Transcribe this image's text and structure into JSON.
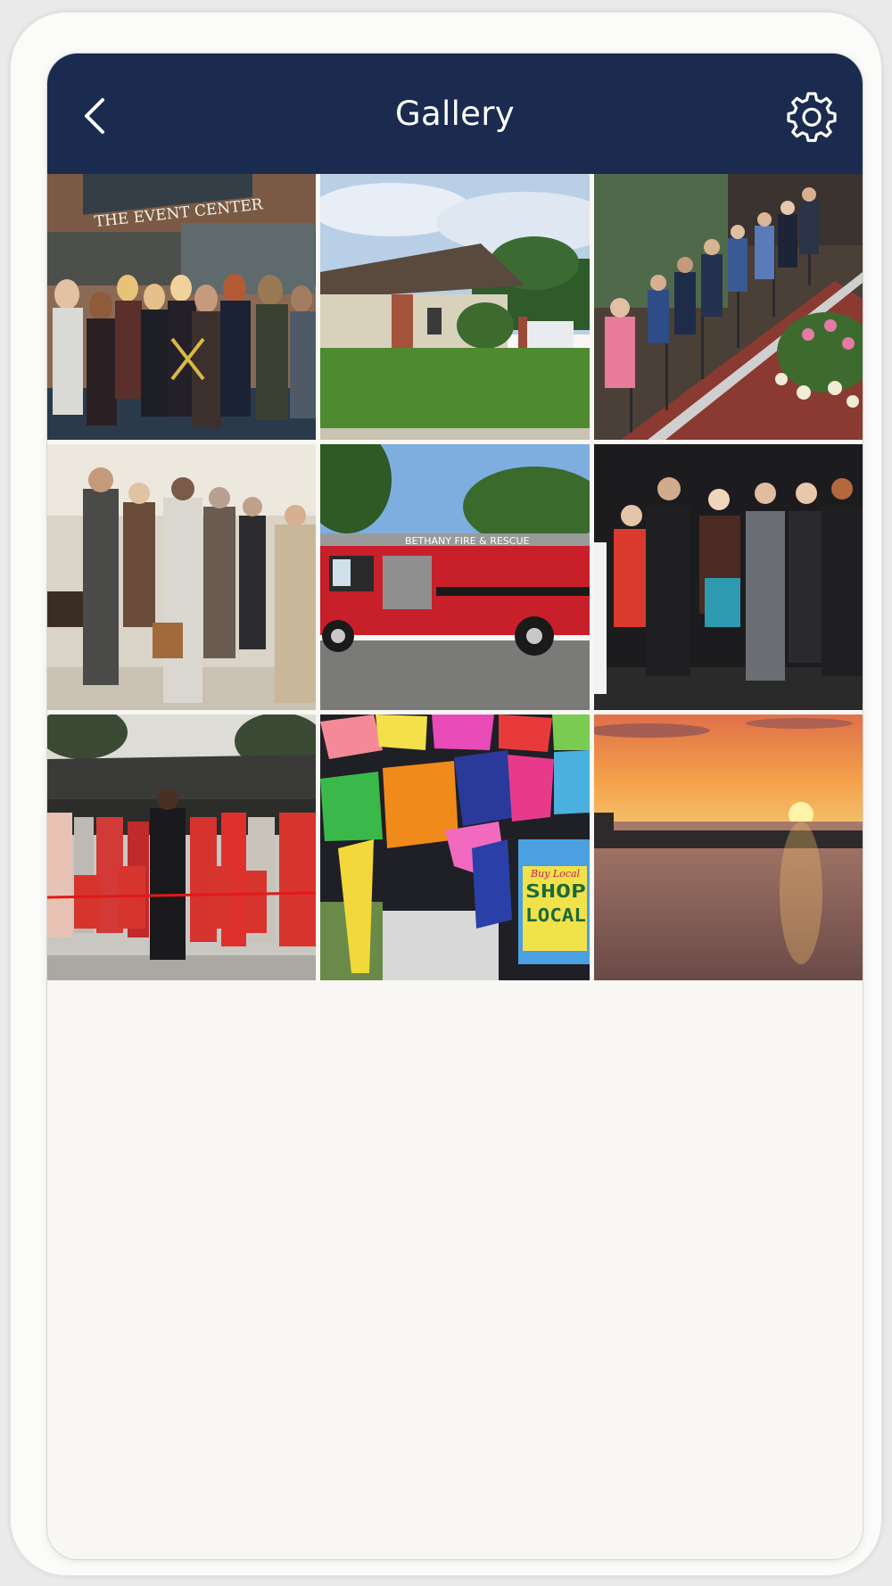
{
  "header": {
    "title": "Gallery",
    "background_color": "#1b2b4f",
    "back_icon": "chevron-left-icon",
    "settings_icon": "gear-icon"
  },
  "gallery": {
    "photo_count": 9,
    "photos": [
      {
        "subject": "event-center-ribbon-cutting",
        "sign_text": "THE EVENT CENTER"
      },
      {
        "subject": "brick-office-building"
      },
      {
        "subject": "group-on-staircase"
      },
      {
        "subject": "indoor-reception"
      },
      {
        "subject": "fire-truck",
        "sign_text": "BETHANY FIRE & RESCUE"
      },
      {
        "subject": "formal-group-on-stage"
      },
      {
        "subject": "outdoor-ribbon-cutting"
      },
      {
        "subject": "papel-picado-banners",
        "sign_text": "Buy Local SHOP LOCAL"
      },
      {
        "subject": "lake-sunset"
      }
    ]
  }
}
